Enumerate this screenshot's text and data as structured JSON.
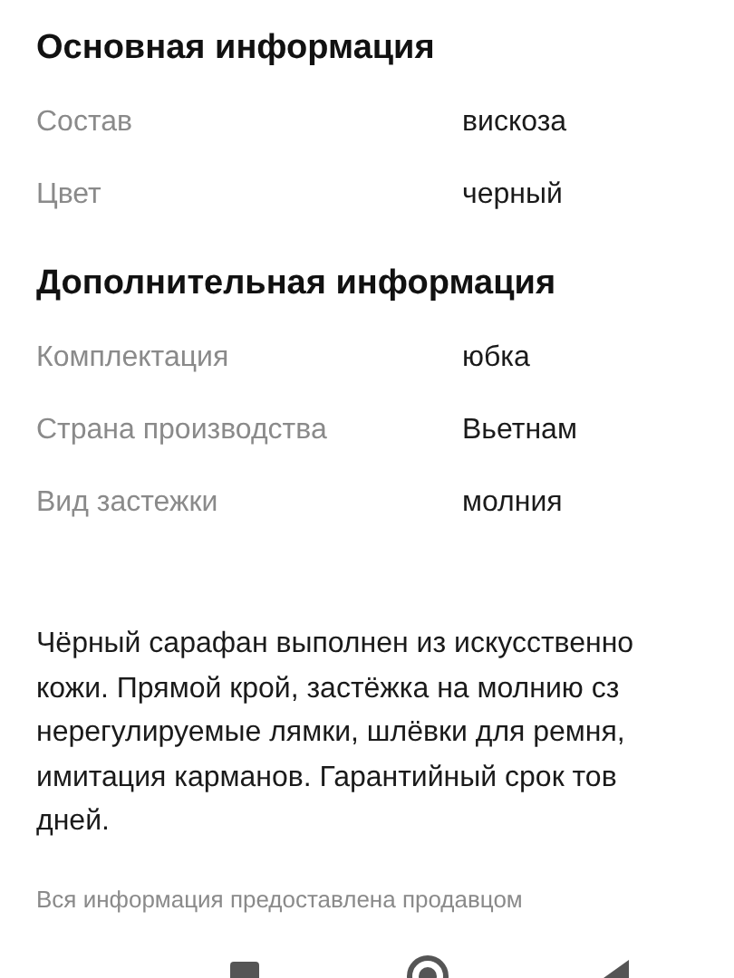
{
  "sections": [
    {
      "title": "Основная информация",
      "rows": [
        {
          "label": "Состав",
          "value": "вискоза"
        },
        {
          "label": "Цвет",
          "value": "черный"
        }
      ]
    },
    {
      "title": "Дополнительная информация",
      "rows": [
        {
          "label": "Комплектация",
          "value": "юбка"
        },
        {
          "label": "Страна производства",
          "value": "Вьетнам"
        },
        {
          "label": "Вид застежки",
          "value": "молния"
        }
      ]
    }
  ],
  "description_lines": [
    "Чёрный сарафан выполнен из искусственно",
    "кожи. Прямой крой, застёжка на молнию сз",
    "нерегулируемые лямки, шлёвки для ремня,",
    "имитация карманов. Гарантийный срок тов",
    "дней."
  ],
  "footnote": "Вся информация предоставлена продавцом"
}
